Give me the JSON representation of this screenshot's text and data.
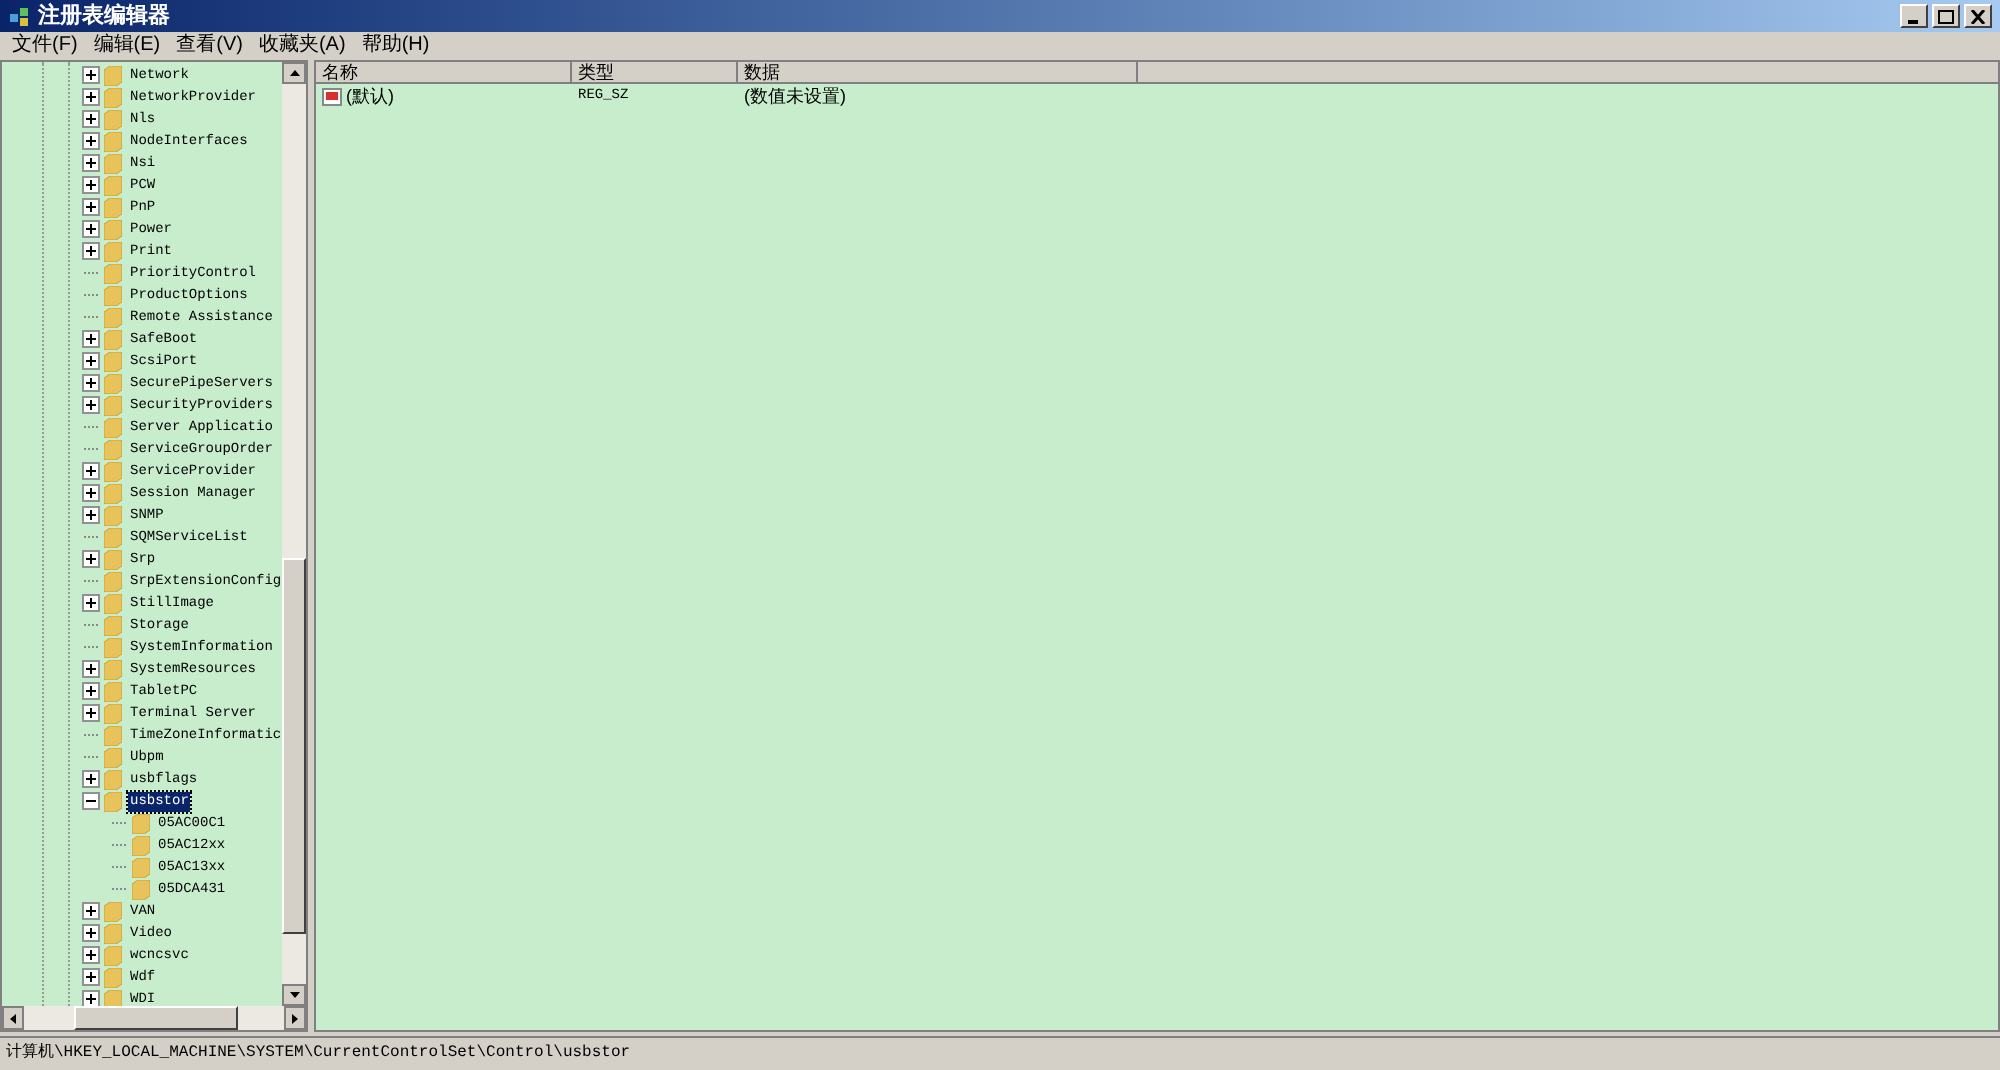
{
  "window": {
    "title": "注册表编辑器"
  },
  "menu": [
    "文件(F)",
    "编辑(E)",
    "查看(V)",
    "收藏夹(A)",
    "帮助(H)"
  ],
  "tree": [
    {
      "label": "Network",
      "expanded": false,
      "selected": false
    },
    {
      "label": "NetworkProvider",
      "expanded": false,
      "selected": false
    },
    {
      "label": "Nls",
      "expanded": false,
      "selected": false
    },
    {
      "label": "NodeInterfaces",
      "expanded": false,
      "selected": false
    },
    {
      "label": "Nsi",
      "expanded": false,
      "selected": false
    },
    {
      "label": "PCW",
      "expanded": false,
      "selected": false
    },
    {
      "label": "PnP",
      "expanded": false,
      "selected": false
    },
    {
      "label": "Power",
      "expanded": false,
      "selected": false
    },
    {
      "label": "Print",
      "expanded": false,
      "selected": false
    },
    {
      "label": "PriorityControl",
      "selected": false
    },
    {
      "label": "ProductOptions",
      "selected": false
    },
    {
      "label": "Remote Assistance",
      "selected": false
    },
    {
      "label": "SafeBoot",
      "expanded": false,
      "selected": false
    },
    {
      "label": "ScsiPort",
      "expanded": false,
      "selected": false
    },
    {
      "label": "SecurePipeServers",
      "expanded": false,
      "selected": false
    },
    {
      "label": "SecurityProviders",
      "expanded": false,
      "selected": false
    },
    {
      "label": "Server Applicatio",
      "selected": false
    },
    {
      "label": "ServiceGroupOrder",
      "selected": false
    },
    {
      "label": "ServiceProvider",
      "expanded": false,
      "selected": false
    },
    {
      "label": "Session Manager",
      "expanded": false,
      "selected": false
    },
    {
      "label": "SNMP",
      "expanded": false,
      "selected": false
    },
    {
      "label": "SQMServiceList",
      "selected": false
    },
    {
      "label": "Srp",
      "expanded": false,
      "selected": false
    },
    {
      "label": "SrpExtensionConfig",
      "selected": false
    },
    {
      "label": "StillImage",
      "expanded": false,
      "selected": false
    },
    {
      "label": "Storage",
      "selected": false
    },
    {
      "label": "SystemInformation",
      "selected": false
    },
    {
      "label": "SystemResources",
      "expanded": false,
      "selected": false
    },
    {
      "label": "TabletPC",
      "expanded": false,
      "selected": false
    },
    {
      "label": "Terminal Server",
      "expanded": false,
      "selected": false
    },
    {
      "label": "TimeZoneInformatic",
      "selected": false
    },
    {
      "label": "Ubpm",
      "selected": false
    },
    {
      "label": "usbflags",
      "expanded": false,
      "selected": false
    },
    {
      "label": "usbstor",
      "expanded": true,
      "selected": true,
      "children": [
        {
          "label": "05AC00C1",
          "selected": false
        },
        {
          "label": "05AC12xx",
          "selected": false
        },
        {
          "label": "05AC13xx",
          "selected": false
        },
        {
          "label": "05DCA431",
          "selected": false
        }
      ]
    },
    {
      "label": "VAN",
      "expanded": false,
      "selected": false
    },
    {
      "label": "Video",
      "expanded": false,
      "selected": false
    },
    {
      "label": "wcncsvc",
      "expanded": false,
      "selected": false
    },
    {
      "label": "Wdf",
      "expanded": false,
      "selected": false
    },
    {
      "label": "WDI",
      "expanded": false,
      "selected": false
    }
  ],
  "table": {
    "columns": [
      "名称",
      "类型",
      "数据"
    ],
    "rows": [
      {
        "name": "(默认)",
        "type": "REG_SZ",
        "data": "(数值未设置)"
      }
    ]
  },
  "status_bar": "计算机\\HKEY_LOCAL_MACHINE\\SYSTEM\\CurrentControlSet\\Control\\usbstor"
}
